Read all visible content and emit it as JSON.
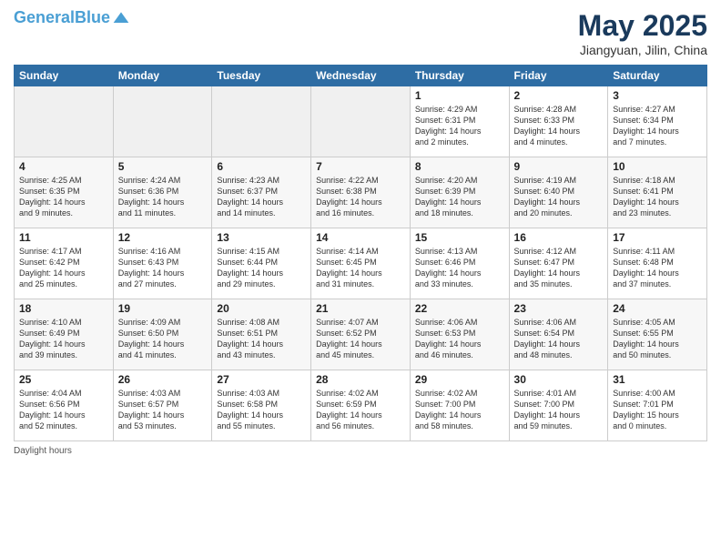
{
  "header": {
    "logo_line1": "General",
    "logo_line2": "Blue",
    "month": "May 2025",
    "location": "Jiangyuan, Jilin, China"
  },
  "days_of_week": [
    "Sunday",
    "Monday",
    "Tuesday",
    "Wednesday",
    "Thursday",
    "Friday",
    "Saturday"
  ],
  "weeks": [
    [
      {
        "day": "",
        "info": ""
      },
      {
        "day": "",
        "info": ""
      },
      {
        "day": "",
        "info": ""
      },
      {
        "day": "",
        "info": ""
      },
      {
        "day": "1",
        "info": "Sunrise: 4:29 AM\nSunset: 6:31 PM\nDaylight: 14 hours\nand 2 minutes."
      },
      {
        "day": "2",
        "info": "Sunrise: 4:28 AM\nSunset: 6:33 PM\nDaylight: 14 hours\nand 4 minutes."
      },
      {
        "day": "3",
        "info": "Sunrise: 4:27 AM\nSunset: 6:34 PM\nDaylight: 14 hours\nand 7 minutes."
      }
    ],
    [
      {
        "day": "4",
        "info": "Sunrise: 4:25 AM\nSunset: 6:35 PM\nDaylight: 14 hours\nand 9 minutes."
      },
      {
        "day": "5",
        "info": "Sunrise: 4:24 AM\nSunset: 6:36 PM\nDaylight: 14 hours\nand 11 minutes."
      },
      {
        "day": "6",
        "info": "Sunrise: 4:23 AM\nSunset: 6:37 PM\nDaylight: 14 hours\nand 14 minutes."
      },
      {
        "day": "7",
        "info": "Sunrise: 4:22 AM\nSunset: 6:38 PM\nDaylight: 14 hours\nand 16 minutes."
      },
      {
        "day": "8",
        "info": "Sunrise: 4:20 AM\nSunset: 6:39 PM\nDaylight: 14 hours\nand 18 minutes."
      },
      {
        "day": "9",
        "info": "Sunrise: 4:19 AM\nSunset: 6:40 PM\nDaylight: 14 hours\nand 20 minutes."
      },
      {
        "day": "10",
        "info": "Sunrise: 4:18 AM\nSunset: 6:41 PM\nDaylight: 14 hours\nand 23 minutes."
      }
    ],
    [
      {
        "day": "11",
        "info": "Sunrise: 4:17 AM\nSunset: 6:42 PM\nDaylight: 14 hours\nand 25 minutes."
      },
      {
        "day": "12",
        "info": "Sunrise: 4:16 AM\nSunset: 6:43 PM\nDaylight: 14 hours\nand 27 minutes."
      },
      {
        "day": "13",
        "info": "Sunrise: 4:15 AM\nSunset: 6:44 PM\nDaylight: 14 hours\nand 29 minutes."
      },
      {
        "day": "14",
        "info": "Sunrise: 4:14 AM\nSunset: 6:45 PM\nDaylight: 14 hours\nand 31 minutes."
      },
      {
        "day": "15",
        "info": "Sunrise: 4:13 AM\nSunset: 6:46 PM\nDaylight: 14 hours\nand 33 minutes."
      },
      {
        "day": "16",
        "info": "Sunrise: 4:12 AM\nSunset: 6:47 PM\nDaylight: 14 hours\nand 35 minutes."
      },
      {
        "day": "17",
        "info": "Sunrise: 4:11 AM\nSunset: 6:48 PM\nDaylight: 14 hours\nand 37 minutes."
      }
    ],
    [
      {
        "day": "18",
        "info": "Sunrise: 4:10 AM\nSunset: 6:49 PM\nDaylight: 14 hours\nand 39 minutes."
      },
      {
        "day": "19",
        "info": "Sunrise: 4:09 AM\nSunset: 6:50 PM\nDaylight: 14 hours\nand 41 minutes."
      },
      {
        "day": "20",
        "info": "Sunrise: 4:08 AM\nSunset: 6:51 PM\nDaylight: 14 hours\nand 43 minutes."
      },
      {
        "day": "21",
        "info": "Sunrise: 4:07 AM\nSunset: 6:52 PM\nDaylight: 14 hours\nand 45 minutes."
      },
      {
        "day": "22",
        "info": "Sunrise: 4:06 AM\nSunset: 6:53 PM\nDaylight: 14 hours\nand 46 minutes."
      },
      {
        "day": "23",
        "info": "Sunrise: 4:06 AM\nSunset: 6:54 PM\nDaylight: 14 hours\nand 48 minutes."
      },
      {
        "day": "24",
        "info": "Sunrise: 4:05 AM\nSunset: 6:55 PM\nDaylight: 14 hours\nand 50 minutes."
      }
    ],
    [
      {
        "day": "25",
        "info": "Sunrise: 4:04 AM\nSunset: 6:56 PM\nDaylight: 14 hours\nand 52 minutes."
      },
      {
        "day": "26",
        "info": "Sunrise: 4:03 AM\nSunset: 6:57 PM\nDaylight: 14 hours\nand 53 minutes."
      },
      {
        "day": "27",
        "info": "Sunrise: 4:03 AM\nSunset: 6:58 PM\nDaylight: 14 hours\nand 55 minutes."
      },
      {
        "day": "28",
        "info": "Sunrise: 4:02 AM\nSunset: 6:59 PM\nDaylight: 14 hours\nand 56 minutes."
      },
      {
        "day": "29",
        "info": "Sunrise: 4:02 AM\nSunset: 7:00 PM\nDaylight: 14 hours\nand 58 minutes."
      },
      {
        "day": "30",
        "info": "Sunrise: 4:01 AM\nSunset: 7:00 PM\nDaylight: 14 hours\nand 59 minutes."
      },
      {
        "day": "31",
        "info": "Sunrise: 4:00 AM\nSunset: 7:01 PM\nDaylight: 15 hours\nand 0 minutes."
      }
    ]
  ],
  "footer": "Daylight hours"
}
